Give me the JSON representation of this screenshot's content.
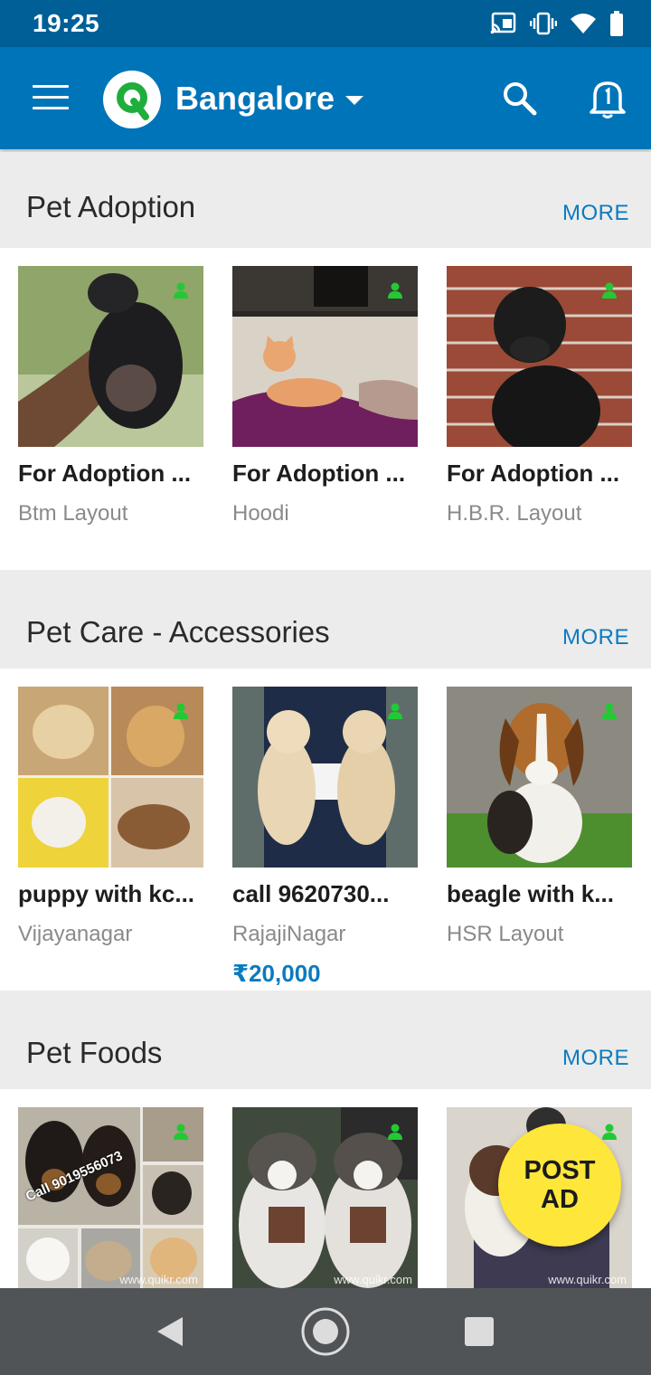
{
  "status_bar": {
    "time": "19:25",
    "icons": [
      "cast-icon",
      "vibrate-icon",
      "wifi-icon",
      "battery-icon"
    ]
  },
  "app_bar": {
    "menu_icon": "hamburger-menu-icon",
    "logo_letter": "Q",
    "city": "Bangalore",
    "search_icon": "search-icon",
    "notification_icon": "bell-icon"
  },
  "colors": {
    "status_bar": "#005f97",
    "app_bar": "#0074b9",
    "accent_link": "#0b7bbf",
    "logo_green": "#1fae3c",
    "fab_yellow": "#ffe63a",
    "verified_green": "#22c934"
  },
  "sections": [
    {
      "title": "Pet Adoption",
      "more_label": "MORE",
      "items": [
        {
          "title": "For Adoption ...",
          "location": "Btm Layout",
          "image": "black puppy held in hand"
        },
        {
          "title": "For Adoption ...",
          "location": "Hoodi",
          "image": "orange kitten on purple cushion"
        },
        {
          "title": "For Adoption ...",
          "location": "H.B.R. Layout",
          "image": "black labrador puppy by brick wall"
        }
      ]
    },
    {
      "title": "Pet Care - Accessories",
      "more_label": "MORE",
      "items": [
        {
          "title": "puppy with kc...",
          "location": "Vijayanagar",
          "image": "collage of puppies"
        },
        {
          "title": "call 9620730...",
          "location": "RajajiNagar",
          "price": "₹20,000",
          "image": "two labrador puppies held"
        },
        {
          "title": "beagle with k...",
          "location": "HSR Layout",
          "image": "beagle puppy on grass"
        }
      ]
    },
    {
      "title": "Pet Foods",
      "more_label": "MORE",
      "items": [
        {
          "title": "",
          "location": "",
          "image": "collage of rottweiler and pug puppies",
          "watermark": "Call 9019556073",
          "site": "www.quikr.com"
        },
        {
          "title": "",
          "location": "",
          "image": "two husky puppies held",
          "site": "www.quikr.com"
        },
        {
          "title": "",
          "location": "",
          "image": "puppy held in arms",
          "site": "www.quikr.com"
        }
      ]
    }
  ],
  "fab": {
    "line1": "POST",
    "line2": "AD"
  },
  "nav_bar": {
    "back_icon": "back-triangle-icon",
    "home_icon": "home-circle-icon",
    "recents_icon": "recents-square-icon"
  }
}
